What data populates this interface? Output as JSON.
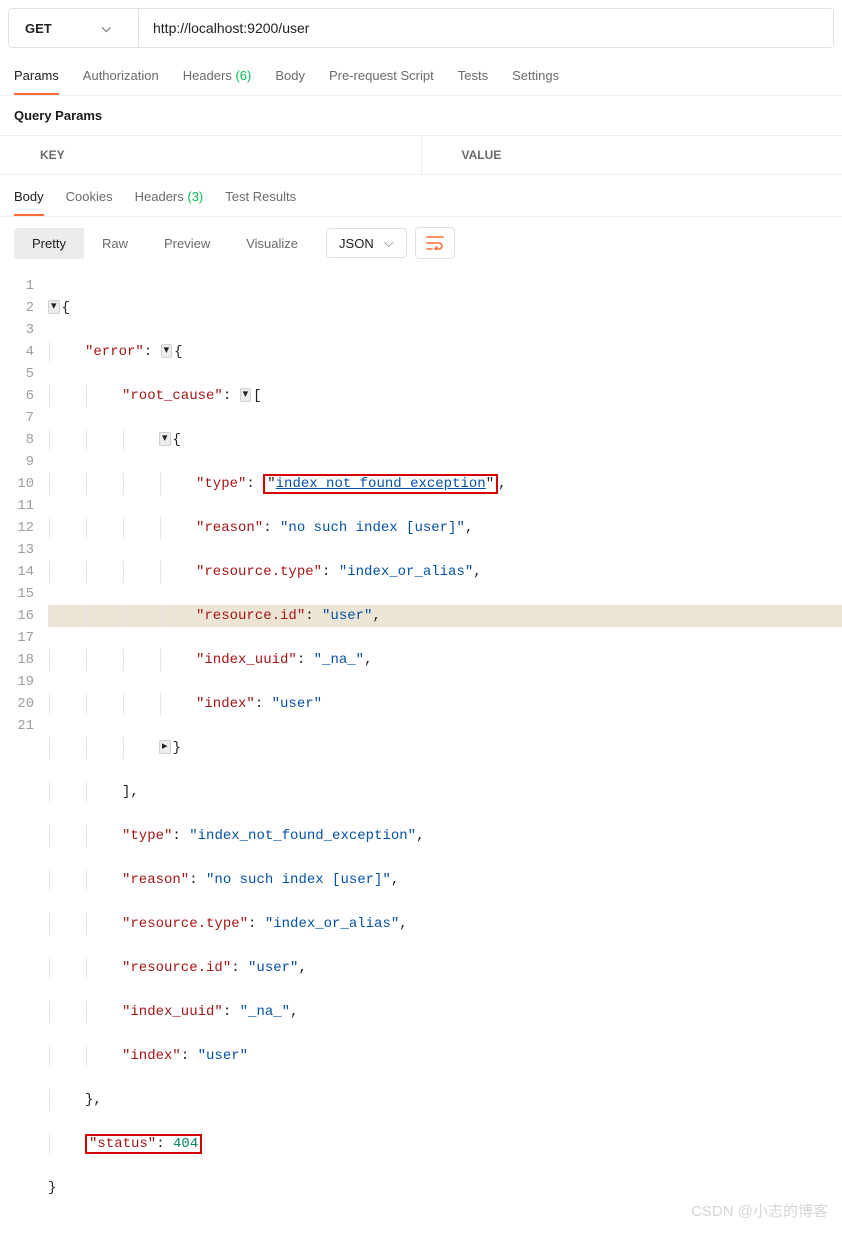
{
  "method": "GET",
  "url": "http://localhost:9200/user",
  "tabs": {
    "params": "Params",
    "auth": "Authorization",
    "headers": "Headers",
    "headers_count": "(6)",
    "body": "Body",
    "prerequest": "Pre-request Script",
    "tests": "Tests",
    "settings": "Settings"
  },
  "section": {
    "query_params": "Query Params",
    "key": "KEY",
    "value": "VALUE"
  },
  "resp_tabs": {
    "body": "Body",
    "cookies": "Cookies",
    "headers": "Headers",
    "headers_count": "(3)",
    "test_results": "Test Results"
  },
  "views": {
    "pretty": "Pretty",
    "raw": "Raw",
    "preview": "Preview",
    "visualize": "Visualize"
  },
  "format": "JSON",
  "code": {
    "error": "\"error\"",
    "root_cause": "\"root_cause\"",
    "type": "\"type\"",
    "type_val": "\"index_not_found_exception\"",
    "reason": "\"reason\"",
    "reason_val": "\"no such index [user]\"",
    "res_type": "\"resource.type\"",
    "res_type_val": "\"index_or_alias\"",
    "res_id": "\"resource.id\"",
    "res_id_val": "\"user\"",
    "index_uuid": "\"index_uuid\"",
    "index_uuid_val": "\"_na_\"",
    "index": "\"index\"",
    "index_val": "\"user\"",
    "status": "\"status\"",
    "status_val": "404"
  },
  "watermark": "CSDN @小志的博客"
}
